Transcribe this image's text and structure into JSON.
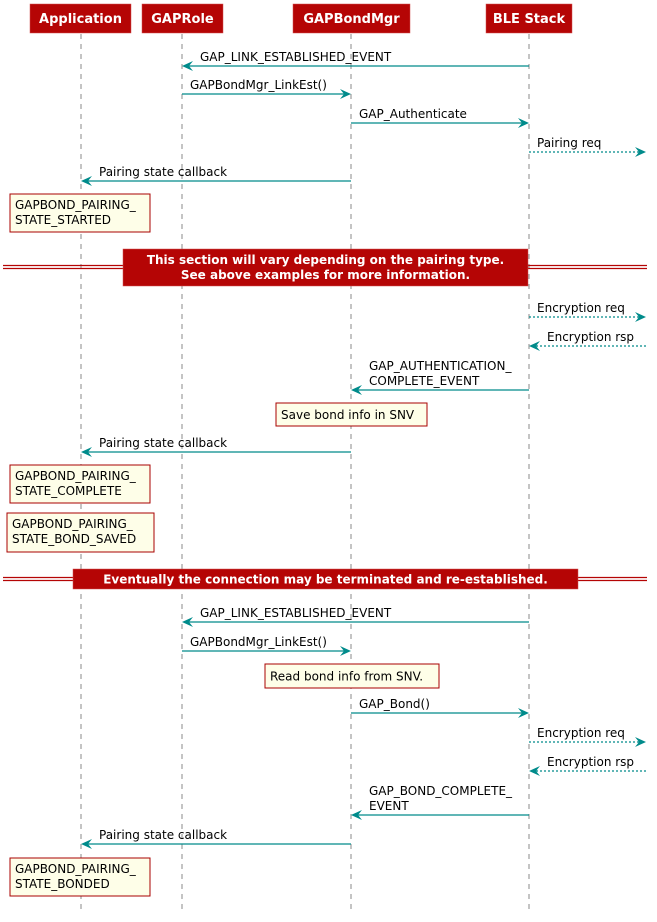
{
  "colors": {
    "participant_bg": "#b50505",
    "participant_text": "#ffffff",
    "arrow": "#008b8b",
    "note_bg": "#fefee8",
    "note_border": "#a80000",
    "divider": "#b50505",
    "lifeline": "#888888"
  },
  "participants": [
    {
      "id": "app",
      "label": "Application"
    },
    {
      "id": "gaprole",
      "label": "GAPRole"
    },
    {
      "id": "bondmgr",
      "label": "GAPBondMgr"
    },
    {
      "id": "stack",
      "label": "BLE Stack"
    }
  ],
  "events": [
    {
      "kind": "message",
      "from": "stack",
      "to": "gaprole",
      "style": "solid",
      "lines": [
        "GAP_LINK_ESTABLISHED_EVENT"
      ]
    },
    {
      "kind": "message",
      "from": "gaprole",
      "to": "bondmgr",
      "style": "solid",
      "lines": [
        "GAPBondMgr_LinkEst()"
      ]
    },
    {
      "kind": "message",
      "from": "bondmgr",
      "to": "stack",
      "style": "solid",
      "lines": [
        "GAP_Authenticate"
      ]
    },
    {
      "kind": "message",
      "from": "stack",
      "to": "right-edge",
      "style": "dotted",
      "lines": [
        "Pairing req"
      ]
    },
    {
      "kind": "message",
      "from": "bondmgr",
      "to": "app",
      "style": "solid",
      "lines": [
        "Pairing state callback"
      ]
    },
    {
      "kind": "note",
      "over": "app",
      "lines": [
        "GAPBOND_PAIRING_",
        "STATE_STARTED"
      ]
    },
    {
      "kind": "divider",
      "lines": [
        "This section will vary depending on the pairing type.",
        "See above examples for more information."
      ]
    },
    {
      "kind": "message",
      "from": "stack",
      "to": "right-edge",
      "style": "dotted",
      "lines": [
        "Encryption req"
      ]
    },
    {
      "kind": "message",
      "from": "right-edge",
      "to": "stack",
      "style": "dotted",
      "lines": [
        "Encryption rsp"
      ]
    },
    {
      "kind": "message",
      "from": "stack",
      "to": "bondmgr",
      "style": "solid",
      "lines": [
        "GAP_AUTHENTICATION_",
        "COMPLETE_EVENT"
      ]
    },
    {
      "kind": "note",
      "over": "bondmgr",
      "lines": [
        "Save bond info in SNV"
      ]
    },
    {
      "kind": "message",
      "from": "bondmgr",
      "to": "app",
      "style": "solid",
      "lines": [
        "Pairing state callback"
      ]
    },
    {
      "kind": "note",
      "over": "app",
      "lines": [
        "GAPBOND_PAIRING_",
        "STATE_COMPLETE"
      ]
    },
    {
      "kind": "note",
      "over": "app",
      "lines": [
        "GAPBOND_PAIRING_",
        "STATE_BOND_SAVED"
      ]
    },
    {
      "kind": "divider",
      "lines": [
        "Eventually the connection may be terminated and re-established."
      ]
    },
    {
      "kind": "message",
      "from": "stack",
      "to": "gaprole",
      "style": "solid",
      "lines": [
        "GAP_LINK_ESTABLISHED_EVENT"
      ]
    },
    {
      "kind": "message",
      "from": "gaprole",
      "to": "bondmgr",
      "style": "solid",
      "lines": [
        "GAPBondMgr_LinkEst()"
      ]
    },
    {
      "kind": "note",
      "over": "bondmgr",
      "lines": [
        "Read bond info from SNV."
      ]
    },
    {
      "kind": "message",
      "from": "bondmgr",
      "to": "stack",
      "style": "solid",
      "lines": [
        "GAP_Bond()"
      ]
    },
    {
      "kind": "message",
      "from": "stack",
      "to": "right-edge",
      "style": "dotted",
      "lines": [
        "Encryption req"
      ]
    },
    {
      "kind": "message",
      "from": "right-edge",
      "to": "stack",
      "style": "dotted",
      "lines": [
        "Encryption rsp"
      ]
    },
    {
      "kind": "message",
      "from": "stack",
      "to": "bondmgr",
      "style": "solid",
      "lines": [
        "GAP_BOND_COMPLETE_",
        "EVENT"
      ]
    },
    {
      "kind": "message",
      "from": "bondmgr",
      "to": "app",
      "style": "solid",
      "lines": [
        "Pairing state callback"
      ]
    },
    {
      "kind": "note",
      "over": "app",
      "lines": [
        "GAPBOND_PAIRING_",
        "STATE_BONDED"
      ]
    }
  ]
}
